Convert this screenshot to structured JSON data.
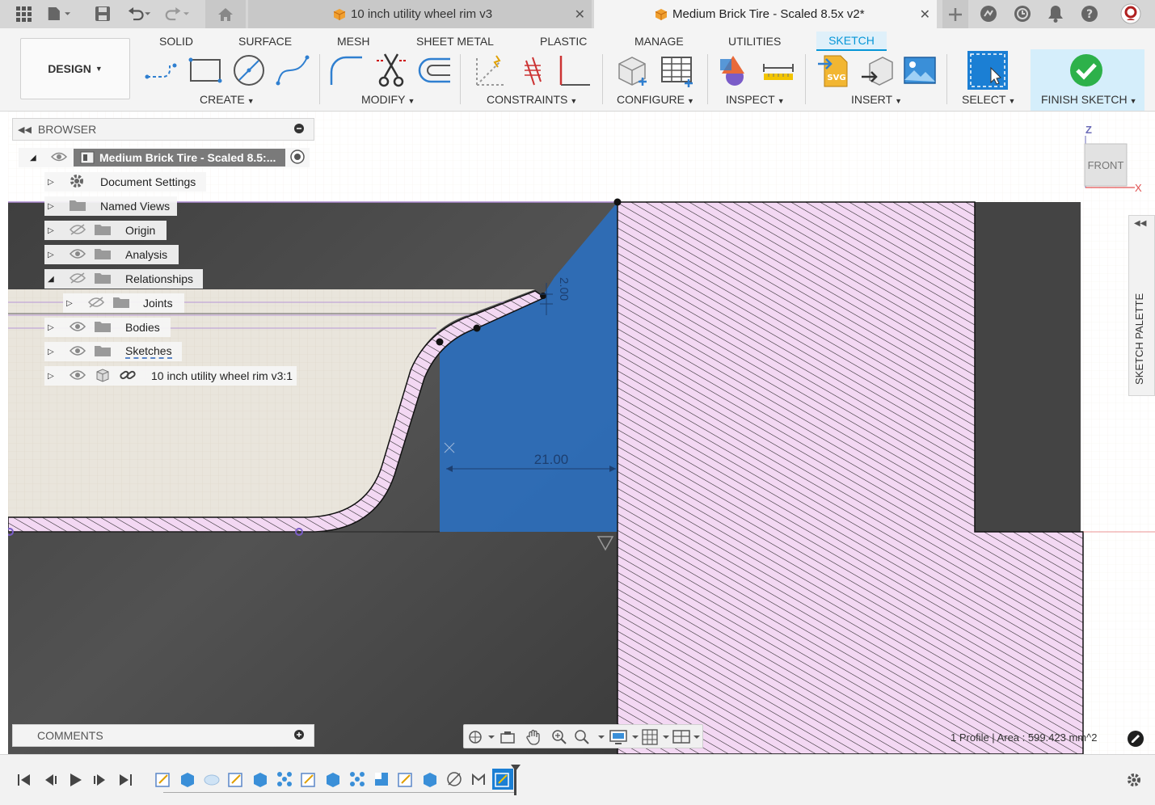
{
  "titlebar": {
    "tabs": [
      {
        "label": "10 inch utility wheel rim v3",
        "active": false
      },
      {
        "label": "Medium Brick Tire - Scaled 8.5x v2*",
        "active": true
      }
    ]
  },
  "toolbar": {
    "design_label": "DESIGN",
    "workspaces": [
      "SOLID",
      "SURFACE",
      "MESH",
      "SHEET METAL",
      "PLASTIC",
      "MANAGE",
      "UTILITIES",
      "SKETCH"
    ],
    "active_workspace": "SKETCH",
    "groups": {
      "create": "CREATE",
      "modify": "MODIFY",
      "constraints": "CONSTRAINTS",
      "configure": "CONFIGURE",
      "inspect": "INSPECT",
      "insert": "INSERT",
      "select": "SELECT",
      "finish": "FINISH SKETCH"
    }
  },
  "browser": {
    "header": "BROWSER",
    "root": "Medium Brick Tire - Scaled 8.5:...",
    "items": [
      {
        "label": "Document Settings"
      },
      {
        "label": "Named Views"
      },
      {
        "label": "Origin"
      },
      {
        "label": "Analysis"
      },
      {
        "label": "Relationships"
      },
      {
        "label": "Joints"
      },
      {
        "label": "Bodies"
      },
      {
        "label": "Sketches"
      },
      {
        "label": "10 inch utility wheel rim v3:1"
      }
    ]
  },
  "comments": {
    "header": "COMMENTS"
  },
  "sketch": {
    "dimensions": [
      "21.00",
      "2.00"
    ],
    "status": "1 Profile | Area : 599.423 mm^2"
  },
  "viewcube": {
    "face": "FRONT",
    "axis_z": "Z",
    "axis_x": "X"
  },
  "palette": {
    "label": "SKETCH PALETTE"
  },
  "colors": {
    "accent": "#0696d7",
    "sketch_fill": "#2c6fbd",
    "hatch_bg": "#f3d8f3",
    "body_dark": "#474747",
    "body_light": "#e9e5dc"
  }
}
